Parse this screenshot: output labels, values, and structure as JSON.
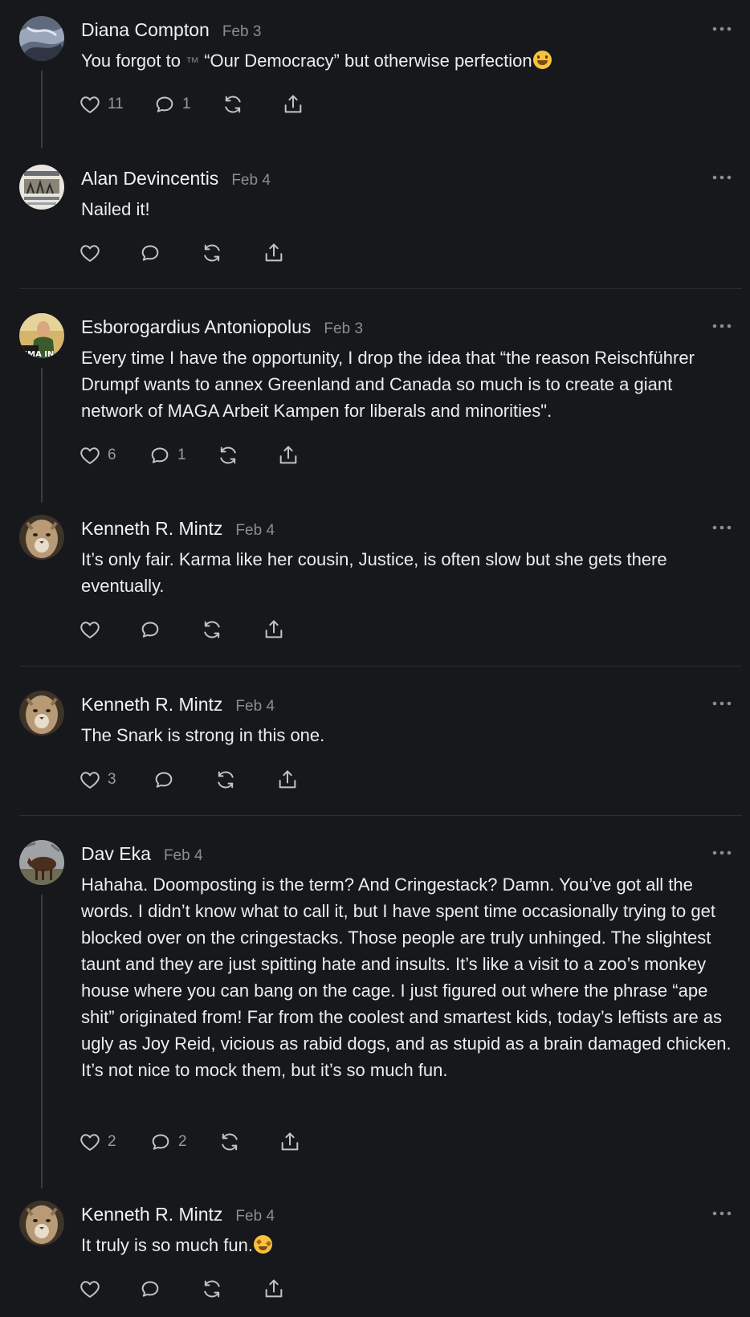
{
  "comments": [
    {
      "name": "Diana Compton",
      "date": "Feb 3",
      "text_before": "You forgot to ",
      "tm_symbol": "™",
      "text_after": " “Our Democracy” but otherwise perfection",
      "emoji": "rolling-on-floor-laughing",
      "likes": "11",
      "replies": "1"
    },
    {
      "name": "Alan Devincentis",
      "date": "Feb 4",
      "text": "Nailed it!"
    },
    {
      "name": "Esborogardius Antoniopolus",
      "date": "Feb 3",
      "text": "Every time I have the opportunity, I drop the idea that “the reason Reischführer Drumpf wants to annex Greenland and Canada so much is to create a giant network of MAGA Arbeit Kampen for liberals and minorities\".",
      "likes": "6",
      "replies": "1"
    },
    {
      "name": "Kenneth R. Mintz",
      "date": "Feb 4",
      "text": "It’s only fair. Karma like her cousin, Justice, is often slow but she gets there eventually."
    },
    {
      "name": "Kenneth R. Mintz",
      "date": "Feb 4",
      "text": "The Snark is strong in this one.",
      "likes": "3"
    },
    {
      "name": "Dav Eka",
      "date": "Feb 4",
      "text": "Hahaha. Doomposting is the term? And Cringestack? Damn. You’ve got all the words. I didn’t know what to call it, but I have spent time occasionally trying to get blocked over on the cringestacks. Those people are truly unhinged. The slightest taunt and they are just spitting hate and insults. It’s like a visit to a zoo’s monkey house where you can bang on the cage. I just figured out where the phrase “ape shit” originated from! Far from the coolest and smartest kids, today’s leftists are as ugly as Joy Reid, vicious as rabid dogs, and as stupid as a brain damaged chicken. It’s not nice to mock them, but it’s so much fun.",
      "likes": "2",
      "replies": "2"
    },
    {
      "name": "Kenneth R. Mintz",
      "date": "Feb 4",
      "text": "It truly is so much fun.",
      "emoji": "star-struck"
    }
  ],
  "colors": {
    "background": "#17181b",
    "text": "#ecedef",
    "muted": "#8c8d91",
    "divider": "#2c2d31",
    "thread_line": "#3a3b3f"
  },
  "icons": [
    "heart-icon",
    "comment-icon",
    "restack-icon",
    "share-icon",
    "more-options-icon"
  ]
}
